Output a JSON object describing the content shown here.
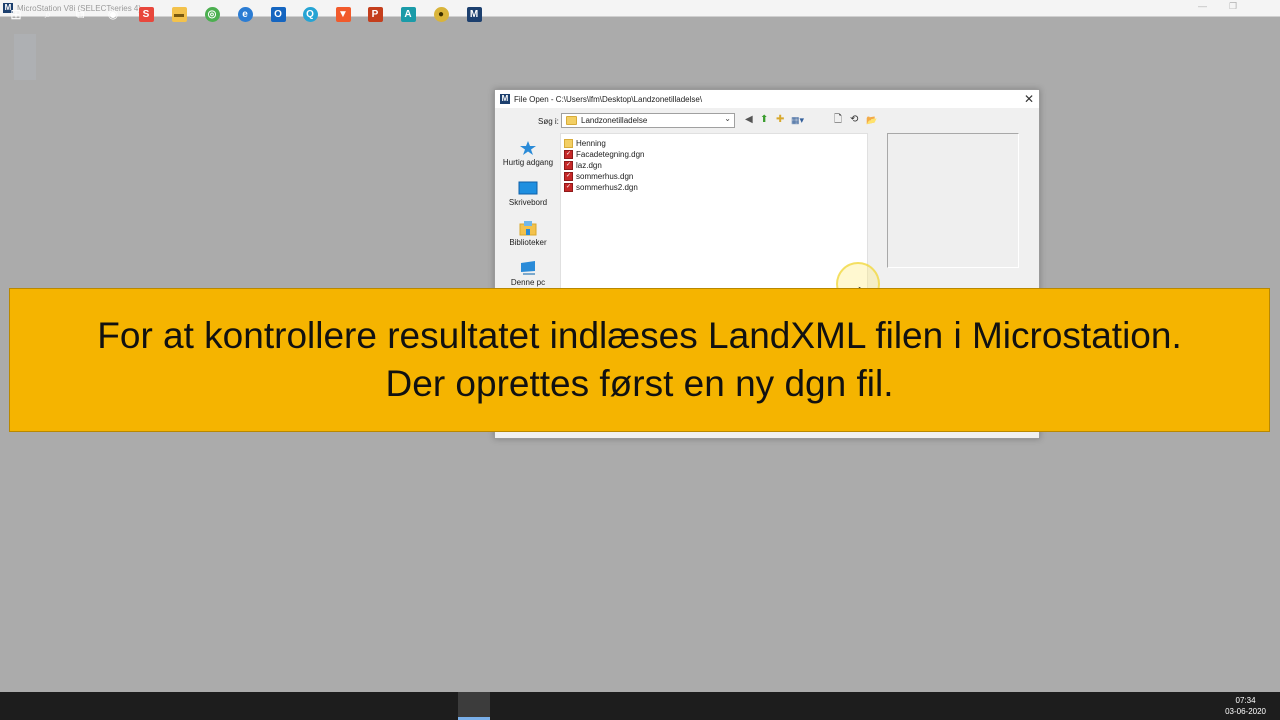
{
  "app": {
    "title": "MicroStation V8i (SELECTseries 4)",
    "logo_glyph": "M",
    "minimize_glyph": "—",
    "restore_glyph": "❐"
  },
  "dialog": {
    "title": "File Open - C:\\Users\\lfm\\Desktop\\Landzonetilladelse\\",
    "close_glyph": "✕",
    "look_in_label": "Søg i:",
    "look_in_value": "Landzonetilladelse",
    "dropdown_glyph": "⌄",
    "toolbar_icons": {
      "back": "◀",
      "up_folder": "⬆",
      "new_folder": "✚",
      "view_menu": "▦▾",
      "new_file": "🗋",
      "refresh": "⟲",
      "browse": "📂"
    },
    "places": [
      {
        "label": "Hurtig adgang",
        "icon": "star-icon"
      },
      {
        "label": "Skrivebord",
        "icon": "desktop-icon"
      },
      {
        "label": "Biblioteker",
        "icon": "libraries-icon"
      },
      {
        "label": "Denne pc",
        "icon": "computer-icon"
      }
    ],
    "files": [
      {
        "name": "Henning",
        "type": "folder"
      },
      {
        "name": "Facadetegning.dgn",
        "type": "dgn"
      },
      {
        "name": "laz.dgn",
        "type": "dgn"
      },
      {
        "name": "sommerhus.dgn",
        "type": "dgn"
      },
      {
        "name": "sommerhus2.dgn",
        "type": "dgn"
      }
    ]
  },
  "caption": {
    "line1": "For at kontrollere resultatet indlæses LandXML filen i Microstation.",
    "line2": "Der oprettes først en ny dgn fil."
  },
  "taskbar": {
    "clock_time": "07:34",
    "clock_date": "03-06-2020",
    "apps": [
      {
        "name": "start",
        "glyph": "⊞"
      },
      {
        "name": "search",
        "glyph": "⌕"
      },
      {
        "name": "task-view",
        "glyph": "⧉"
      },
      {
        "name": "cortana",
        "glyph": "◉"
      },
      {
        "name": "snagit",
        "glyph": "S",
        "color": "#e8473c"
      },
      {
        "name": "file-explorer",
        "glyph": "▬",
        "color": "#f3c24c"
      },
      {
        "name": "chrome",
        "glyph": "◎",
        "color": "#4caf50"
      },
      {
        "name": "edge",
        "glyph": "e",
        "color": "#2b7cd3"
      },
      {
        "name": "outlook",
        "glyph": "O",
        "color": "#1565c0"
      },
      {
        "name": "app-q",
        "glyph": "Q",
        "color": "#26a4d4"
      },
      {
        "name": "brave",
        "glyph": "▼",
        "color": "#f15a2b"
      },
      {
        "name": "powerpoint",
        "glyph": "P",
        "color": "#c43e1c"
      },
      {
        "name": "autocad",
        "glyph": "A",
        "color": "#1a9ba8"
      },
      {
        "name": "app-circle",
        "glyph": "●",
        "color": "#d9b43a"
      },
      {
        "name": "microstation",
        "glyph": "M",
        "color": "#1c3f6e"
      }
    ]
  }
}
